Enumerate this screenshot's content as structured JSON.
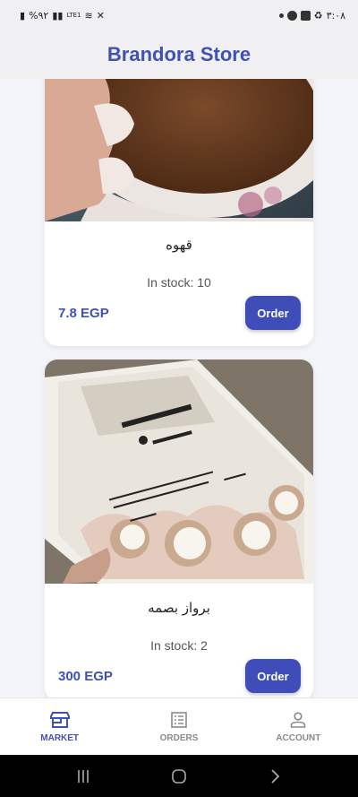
{
  "status_bar": {
    "left_text": "%٩٢",
    "network": "LTE1",
    "time": "٣:٠٨"
  },
  "header": {
    "title": "Brandora Store"
  },
  "products": [
    {
      "name": "قهوه",
      "stock": "In stock: 10",
      "price": "7.8 EGP",
      "order_label": "Order"
    },
    {
      "name": "برواز بصمه",
      "stock": "In stock: 2",
      "price": "300 EGP",
      "order_label": "Order"
    }
  ],
  "nav": [
    {
      "label": "MARKET",
      "icon": "store-icon",
      "active": true
    },
    {
      "label": "ORDERS",
      "icon": "list-icon",
      "active": false
    },
    {
      "label": "ACCOUNT",
      "icon": "person-icon",
      "active": false
    }
  ],
  "colors": {
    "accent": "#3f51b5",
    "button": "#3f4db8",
    "background": "#f4f5fa"
  }
}
